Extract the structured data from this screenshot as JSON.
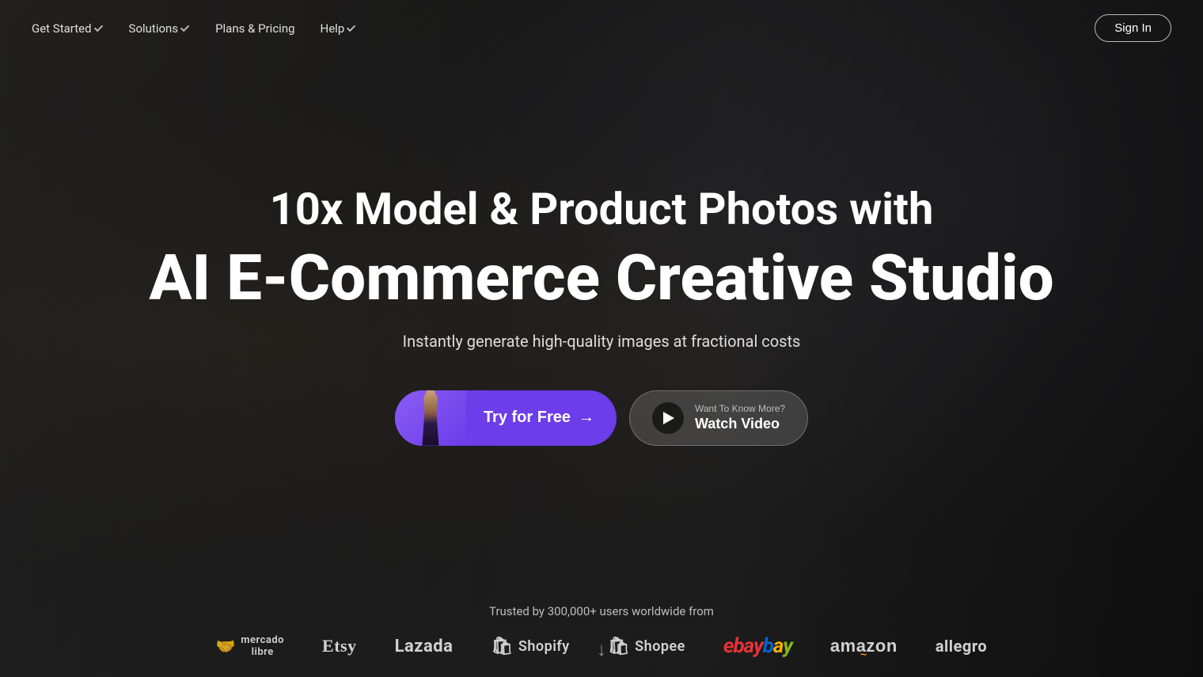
{
  "nav": {
    "items": [
      {
        "label": "Get Started",
        "hasDropdown": true,
        "name": "get-started"
      },
      {
        "label": "Solutions",
        "hasDropdown": true,
        "name": "solutions"
      },
      {
        "label": "Plans & Pricing",
        "hasDropdown": false,
        "name": "plans-pricing"
      },
      {
        "label": "Help",
        "hasDropdown": true,
        "name": "help"
      }
    ],
    "sign_in_label": "Sign In"
  },
  "hero": {
    "title_line1": "10x Model & Product Photos with",
    "title_line2": "AI E-Commerce Creative Studio",
    "subtitle": "Instantly generate high-quality images at fractional costs",
    "cta_primary_label": "Try for Free",
    "cta_primary_arrow": "→",
    "cta_secondary_eyebrow": "Want To Know More?",
    "cta_secondary_label": "Watch Video"
  },
  "trusted": {
    "text": "Trusted by 300,000+ users worldwide from",
    "brands": [
      {
        "label": "mercado libre",
        "name": "mercadolibre",
        "style": "mercadolibre"
      },
      {
        "label": "Etsy",
        "name": "etsy",
        "style": "etsy"
      },
      {
        "label": "Lazada",
        "name": "lazada",
        "style": "lazada"
      },
      {
        "label": "Shopify",
        "name": "shopify",
        "style": "shopify"
      },
      {
        "label": "Shopee",
        "name": "shopee",
        "style": "shopee"
      },
      {
        "label": "ebay",
        "name": "ebay",
        "style": "ebay"
      },
      {
        "label": "amazon",
        "name": "amazon",
        "style": "amazon"
      },
      {
        "label": "allegro",
        "name": "allegro",
        "style": "allegro"
      }
    ]
  },
  "scroll_indicator": "↓"
}
